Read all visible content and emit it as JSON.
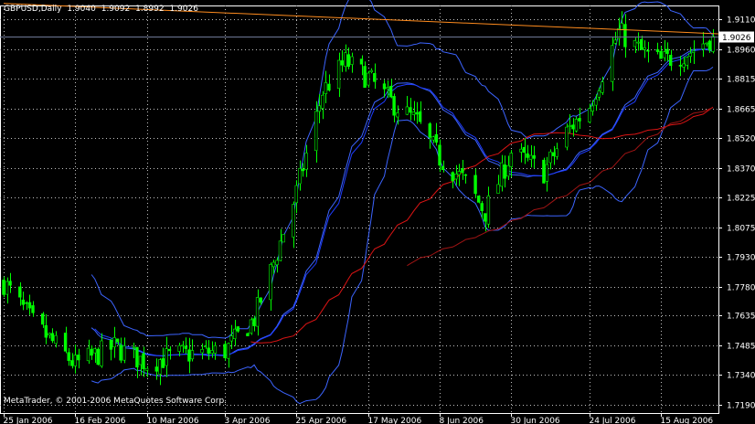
{
  "header": {
    "symbol": "GBPUSD",
    "period": "Daily",
    "open": "1.9040",
    "high": "1.9092",
    "low": "1.8992",
    "close": "1.9026"
  },
  "copyright": "MetaTrader, © 2001-2006 MetaQuotes Software Corp.",
  "colors": {
    "background": "#000000",
    "grid": "#c0c0c0",
    "candle_up": "#00ff00",
    "candle_down": "#00ff00",
    "bollinger": "#3c64ff",
    "ma_blue": "#1e3cff",
    "ma_red": "#dc1414",
    "ma_darkred": "#a01414",
    "trendline": "#ff8c1e",
    "current_price_line": "#6e7896",
    "price_tag_bg": "#ffffff"
  },
  "chart_data": {
    "type": "candlestick",
    "symbol": "GBPUSD",
    "timeframe": "Daily",
    "ylim": [
      1.715,
      1.918
    ],
    "y_ticks": [
      "1.9110",
      "1.8960",
      "1.8815",
      "1.8665",
      "1.8520",
      "1.8370",
      "1.8225",
      "1.8075",
      "1.7930",
      "1.7780",
      "1.7635",
      "1.7485",
      "1.7340",
      "1.7190"
    ],
    "x_ticks": [
      "25 Jan 2006",
      "16 Feb 2006",
      "10 Mar 2006",
      "3 Apr 2006",
      "25 Apr 2006",
      "17 May 2006",
      "8 Jun 2006",
      "30 Jun 2006",
      "24 Jul 2006",
      "15 Aug 2006"
    ],
    "current_price": "1.9026",
    "trendline": {
      "from": [
        "25 Jan 2006",
        1.919
      ],
      "to": [
        "31 Aug 2006",
        1.903
      ]
    },
    "anchors": [
      [
        "25 Jan 2006",
        1.78
      ],
      [
        "3 Feb 2006",
        1.76
      ],
      [
        "16 Feb 2006",
        1.739
      ],
      [
        "28 Feb 2006",
        1.748
      ],
      [
        "10 Mar 2006",
        1.74
      ],
      [
        "20 Mar 2006",
        1.744
      ],
      [
        "3 Apr 2006",
        1.746
      ],
      [
        "12 Apr 2006",
        1.762
      ],
      [
        "18 Apr 2006",
        1.79
      ],
      [
        "25 Apr 2006",
        1.825
      ],
      [
        "3 May 2006",
        1.875
      ],
      [
        "10 May 2006",
        1.89
      ],
      [
        "17 May 2006",
        1.882
      ],
      [
        "24 May 2006",
        1.87
      ],
      [
        "1 Jun 2006",
        1.86
      ],
      [
        "8 Jun 2006",
        1.842
      ],
      [
        "16 Jun 2006",
        1.83
      ],
      [
        "22 Jun 2006",
        1.815
      ],
      [
        "30 Jun 2006",
        1.845
      ],
      [
        "10 Jul 2006",
        1.835
      ],
      [
        "17 Jul 2006",
        1.855
      ],
      [
        "24 Jul 2006",
        1.868
      ],
      [
        "2 Aug 2006",
        1.905
      ],
      [
        "9 Aug 2006",
        1.895
      ],
      [
        "15 Aug 2006",
        1.89
      ],
      [
        "24 Aug 2006",
        1.895
      ],
      [
        "31 Aug 2006",
        1.9026
      ]
    ],
    "bollinger_period": 20,
    "moving_averages": [
      {
        "period": 21,
        "color": "#1e3cff"
      },
      {
        "period": 55,
        "color": "#dc1414"
      },
      {
        "period": 89,
        "color": "#a01414"
      }
    ]
  }
}
